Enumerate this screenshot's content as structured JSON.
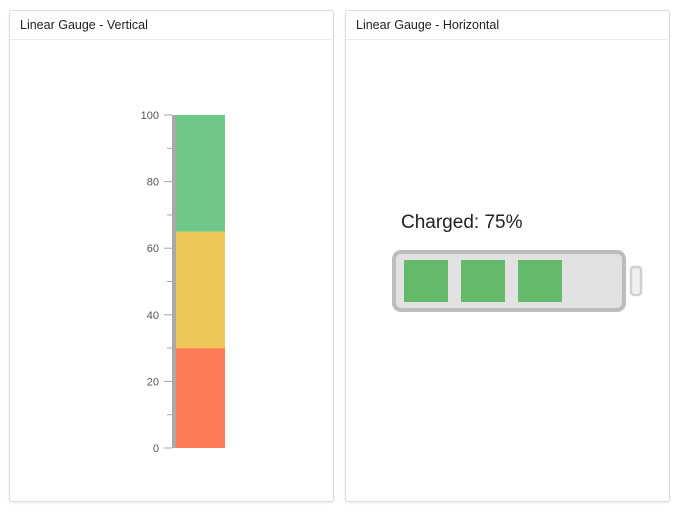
{
  "vertical_gauge": {
    "title": "Linear Gauge - Vertical",
    "scale": {
      "min": 0,
      "max": 100,
      "major_ticks": [
        0,
        20,
        40,
        60,
        80,
        100
      ],
      "minor_step": 10
    },
    "ranges": [
      {
        "from": 0,
        "to": 30,
        "color": "#ff7b55"
      },
      {
        "from": 30,
        "to": 65,
        "color": "#ecc85a"
      },
      {
        "from": 65,
        "to": 100,
        "color": "#6fc88a"
      }
    ],
    "colors": {
      "axis": "#a9a9a9",
      "tick_label": "#555555"
    }
  },
  "horizontal_gauge": {
    "title": "Linear Gauge - Horizontal",
    "label_text": "Charged: 75%",
    "charge_value": 75,
    "cells_total": 4,
    "cells_filled": 3,
    "colors": {
      "cell": "#64b96b",
      "shell": "#bdbdbd",
      "shell_fill": "#e2e2e2"
    }
  }
}
